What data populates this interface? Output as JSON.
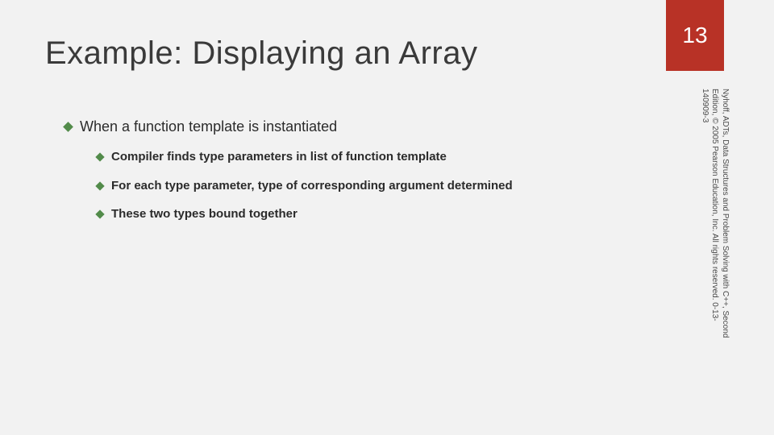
{
  "colors": {
    "accent": "#b83226",
    "bullet": "#528b4a"
  },
  "page_number": "13",
  "title": "Example: Displaying an Array",
  "main_point": "When a function template is instantiated",
  "sub_points": [
    "Compiler finds type parameters in list of function template",
    "For each type parameter, type of corresponding argument determined",
    "These two types bound together"
  ],
  "attribution": "Nyhoff, ADTs, Data Structures and Problem Solving with C++, Second Edition, © 2005 Pearson Education, Inc. All rights reserved. 0-13-140909-3"
}
